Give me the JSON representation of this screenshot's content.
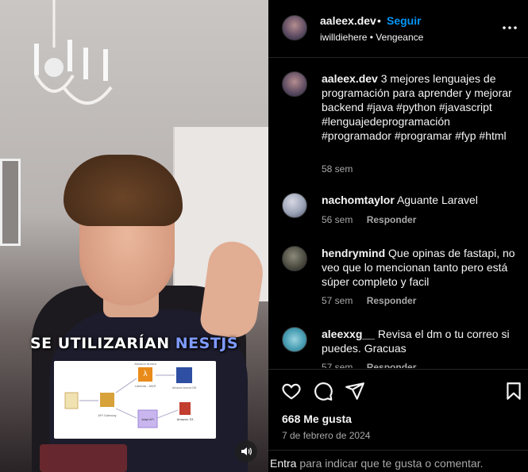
{
  "post": {
    "username": "aaleex.dev",
    "dot": "•",
    "follow_label": "Seguir",
    "audio": "iwilldiehere • Vengeance",
    "more_icon": "more-horizontal-icon"
  },
  "video": {
    "overlay_word1": "SE UTILIZARÍAN",
    "overlay_word2": "NESTJS",
    "diagram_label_lambda": "Lambda - AWS",
    "diagram_label_gateway": "API Gateway",
    "diagram_label_rds": "Amazon Aurora DB",
    "diagram_label_s3": "Amazon S3",
    "diagram_label_top": "Amazon Aurora",
    "diagram_label_mid": "Adapt API",
    "mute_icon": "speaker-icon"
  },
  "caption": {
    "username": "aaleex.dev",
    "text": "3 mejores lenguajes de programación para aprender y mejorar backend #java #python #javascript #lenguajedeprogramación #programador #programar #fyp #html",
    "time": "58 sem"
  },
  "comments": [
    {
      "username": "nachomtaylor",
      "text": "Aguante Laravel",
      "time": "56 sem",
      "reply": "Responder"
    },
    {
      "username": "hendrymind",
      "text": "Que opinas de fastapi, no veo que lo mencionan tanto pero está súper completo y facil",
      "time": "57 sem",
      "reply": "Responder"
    },
    {
      "username": "aleexxg__",
      "text": "Revisa el dm o tu correo si puedes. Gracuas",
      "time": "57 sem",
      "reply": "Responder"
    }
  ],
  "actions": {
    "like_icon": "heart-icon",
    "comment_icon": "comment-icon",
    "share_icon": "send-icon",
    "save_icon": "bookmark-icon",
    "likes": "668 Me gusta",
    "date": "7 de febrero de 2024"
  },
  "add_comment": {
    "entra": "Entra",
    "rest": " para indicar que te gusta o comentar."
  },
  "colors": {
    "link": "#0095f6",
    "muted": "#a8a8a8",
    "background": "#000000",
    "overlay_accent": "#7f9bff"
  }
}
